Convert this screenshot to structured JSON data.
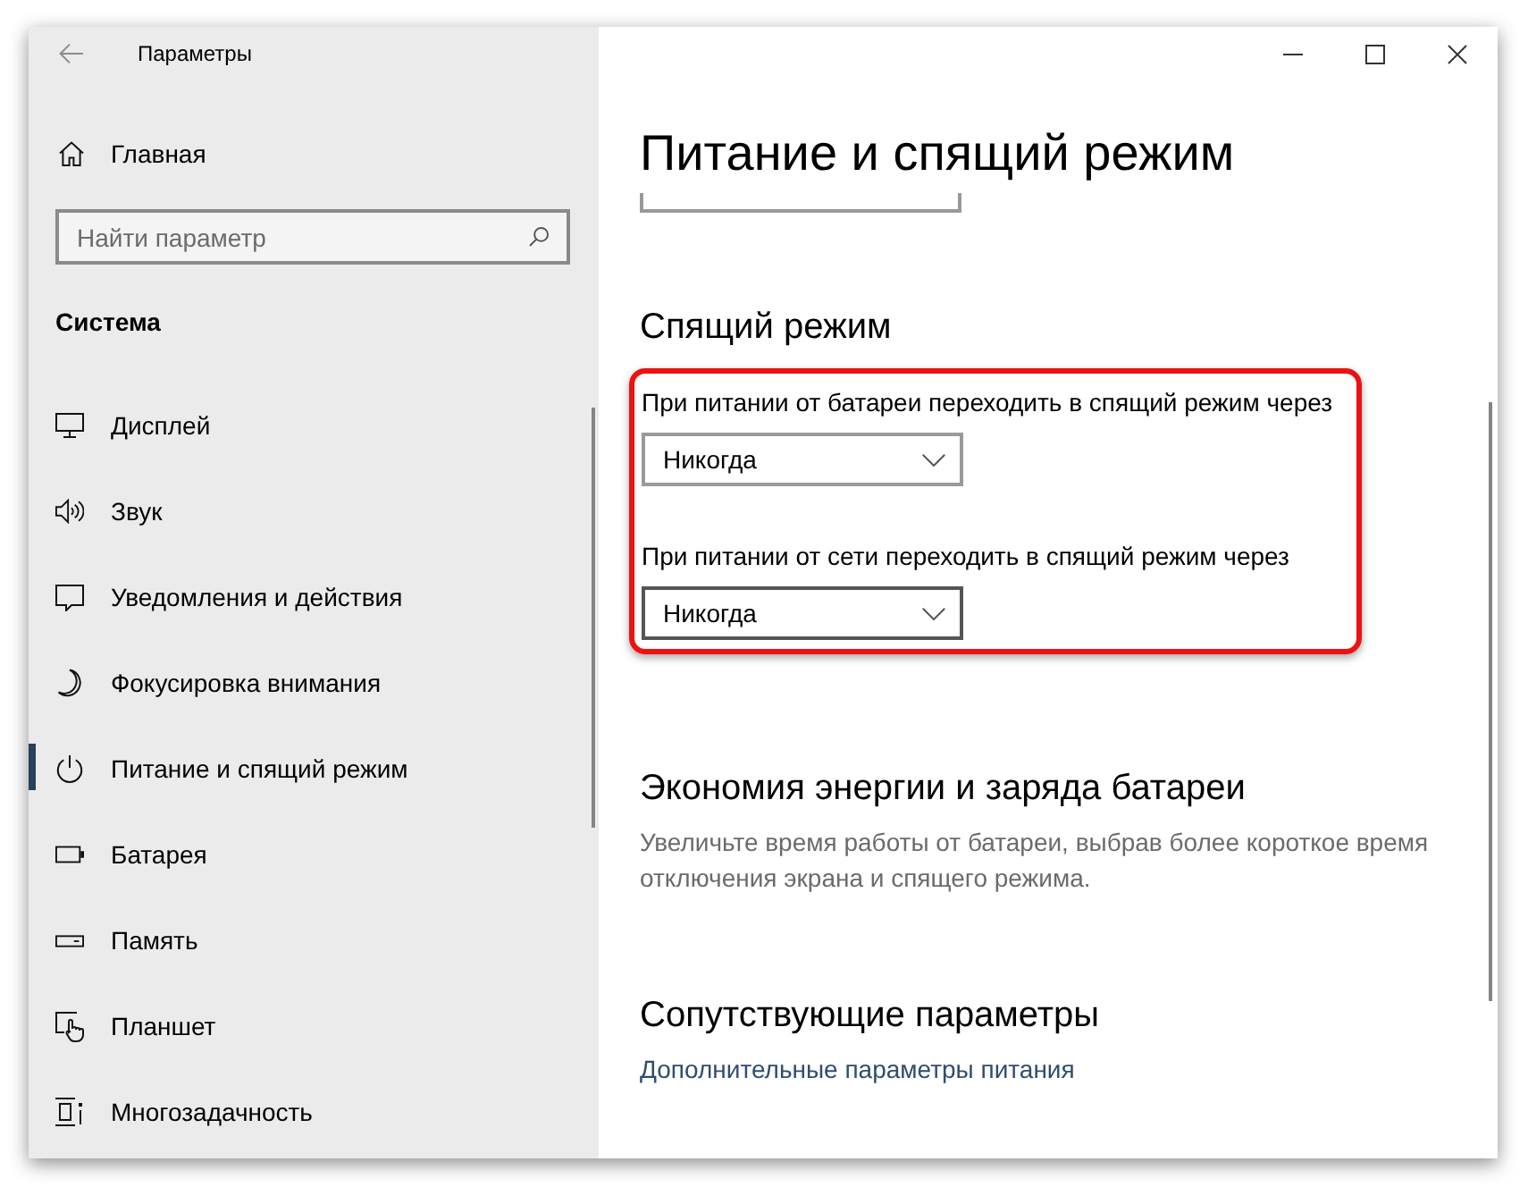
{
  "window": {
    "title": "Параметры"
  },
  "sidebar": {
    "home": "Главная",
    "search": {
      "placeholder": "Найти параметр"
    },
    "section": "Система",
    "items": [
      {
        "label": "Дисплей",
        "selected": false
      },
      {
        "label": "Звук",
        "selected": false
      },
      {
        "label": "Уведомления и действия",
        "selected": false
      },
      {
        "label": "Фокусировка внимания",
        "selected": false
      },
      {
        "label": "Питание и спящий режим",
        "selected": true
      },
      {
        "label": "Батарея",
        "selected": false
      },
      {
        "label": "Память",
        "selected": false
      },
      {
        "label": "Планшет",
        "selected": false
      },
      {
        "label": "Многозадачность",
        "selected": false
      }
    ]
  },
  "page": {
    "title": "Питание и спящий режим",
    "sleep": {
      "heading": "Спящий режим",
      "highlighted": true,
      "settings": [
        {
          "label": "При питании от батареи переходить в спящий режим через",
          "value": "Никогда",
          "hovered": false
        },
        {
          "label": "При питании от сети переходить в спящий режим через",
          "value": "Никогда",
          "hovered": true
        }
      ]
    },
    "battery_saving": {
      "heading": "Экономия энергии и заряда батареи",
      "description": "Увеличьте время работы от батареи, выбрав более короткое время отключения экрана и спящего режима."
    },
    "related": {
      "heading": "Сопутствующие параметры",
      "links": [
        "Дополнительные параметры питания"
      ]
    }
  }
}
